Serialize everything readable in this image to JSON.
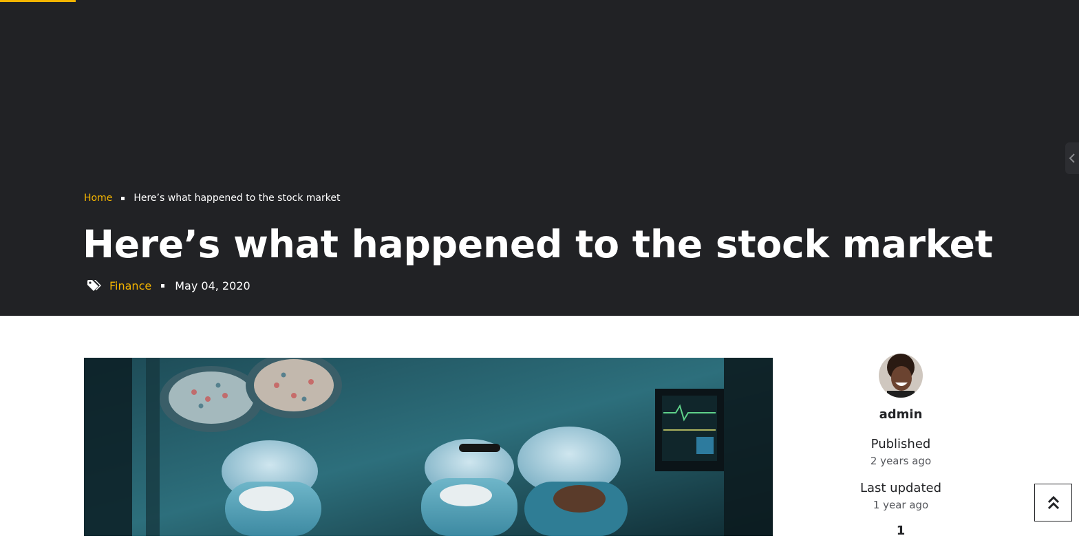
{
  "reading_progress": 0.07,
  "colors": {
    "accent": "#f4b400",
    "hero_bg": "#212225",
    "text_dark": "#212225"
  },
  "breadcrumb": {
    "home": "Home",
    "current": "Here’s what happened to the stock market"
  },
  "post": {
    "title": "Here’s what happened to the stock market",
    "category": "Finance",
    "date": "May 04, 2020"
  },
  "author": {
    "name": "admin",
    "published_label": "Published",
    "published_value": "2 years ago",
    "updated_label": "Last updated",
    "updated_value": "1 year ago",
    "count": "1"
  },
  "icons": {
    "tag": "tags-icon",
    "side_toggle": "chevron-left-icon",
    "back_to_top": "double-chevron-up-icon"
  }
}
